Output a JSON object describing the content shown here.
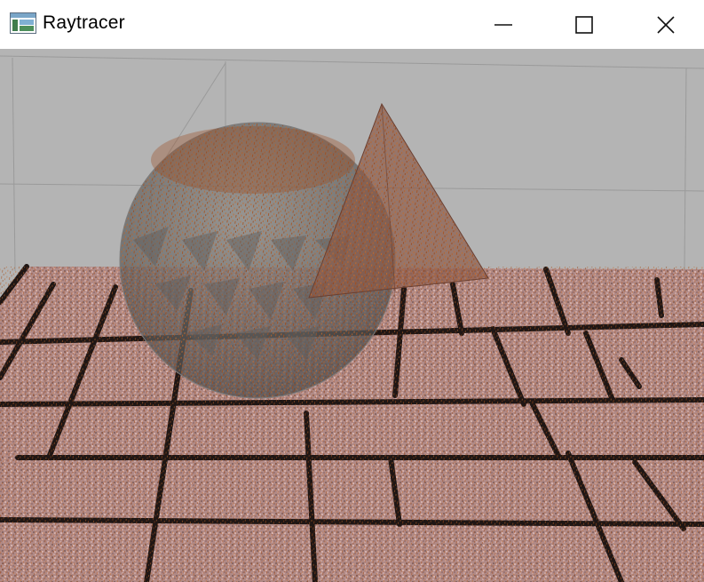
{
  "window": {
    "title": "Raytracer",
    "app_icon": "window-app-icon"
  },
  "controls": {
    "minimize_icon": "minimize-icon",
    "maximize_icon": "maximize-icon",
    "close_icon": "close-icon"
  },
  "scene": {
    "background_color": "#b4b4b4",
    "floor_color": "#b18a86",
    "mortar_color": "#1f1614",
    "sphere_color": "#6f6f6f",
    "pyramid_color": "#8a5a48",
    "speckle_color": "#a8501c"
  }
}
